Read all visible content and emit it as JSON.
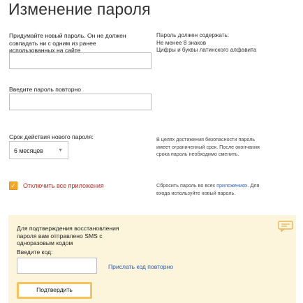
{
  "page": {
    "title": "Изменение пароля"
  },
  "new_password": {
    "label_lines": [
      "Придумайте новый пароль. Он не должен",
      "совпадать ни с одним из ранее",
      "использованных на сайте"
    ],
    "value": ""
  },
  "requirements": {
    "lines": [
      "Пароль должен содержать:",
      "Не менее 8 знаков",
      "Цифры и буквы латинского алфавита"
    ]
  },
  "repeat_password": {
    "label": "Введите пароль повторно",
    "value": ""
  },
  "validity": {
    "label": "Срок действия нового пароля:",
    "selected": "6 месяцев",
    "hint_lines": [
      "В целях достижения безопасности пароль",
      "имеет ограниченный срок. После окончания",
      "срока пароль необходимо сменить."
    ]
  },
  "apps": {
    "checkbox_checked": true,
    "checkbox_label": "Отключить все приложения",
    "hint_line1_prefix": "Сбросить пароль во всех ",
    "hint_line1_link": "приложениях",
    "hint_line1_suffix": ". Для",
    "hint_line2": "входа используйте новый пароль."
  },
  "sms": {
    "message_lines": [
      "Для подтверждения восстановления",
      "пароля вам отправлено SMS с",
      "одноразовым кодом"
    ],
    "code_label": "Введите код:",
    "code_value": "",
    "resend_link": "Прислать код повторно",
    "confirm_button": "Подтвердить"
  },
  "colors": {
    "accent_orange": "#f5a623",
    "panel_bg": "#fdf4dc",
    "button_border": "#f5c35c",
    "link_blue": "#2a5db0",
    "warning_red": "#b5332b"
  },
  "icons": {
    "panel_icon": "message-bubble-icon",
    "select_arrow": "chevron-down-icon",
    "checkbox_mark": "checkmark-icon"
  }
}
